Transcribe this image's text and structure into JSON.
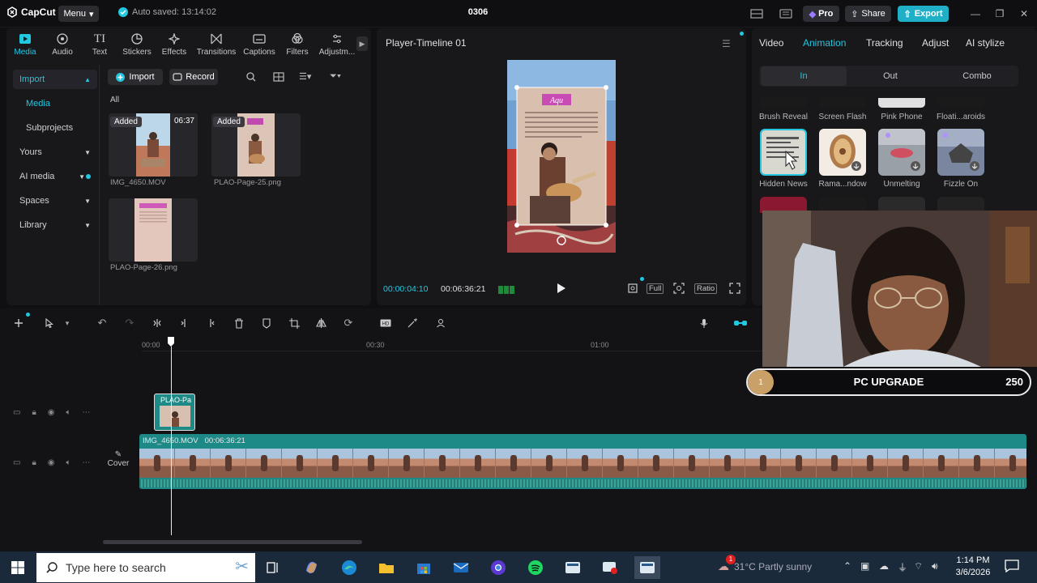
{
  "app": {
    "name": "CapCut",
    "menu_label": "Menu",
    "autosave_text": "Auto saved: 13:14:02",
    "project_name": "0306",
    "pro_label": "Pro",
    "share_label": "Share",
    "export_label": "Export"
  },
  "media_toolbar": {
    "tabs": [
      {
        "label": "Media",
        "icon": "media-icon"
      },
      {
        "label": "Audio",
        "icon": "audio-icon"
      },
      {
        "label": "Text",
        "icon": "text-icon"
      },
      {
        "label": "Stickers",
        "icon": "stickers-icon"
      },
      {
        "label": "Effects",
        "icon": "effects-icon"
      },
      {
        "label": "Transitions",
        "icon": "transitions-icon"
      },
      {
        "label": "Captions",
        "icon": "captions-icon"
      },
      {
        "label": "Filters",
        "icon": "filters-icon"
      },
      {
        "label": "Adjustm...",
        "icon": "adjustment-icon"
      }
    ]
  },
  "sidebar": {
    "items": [
      {
        "label": "Import"
      },
      {
        "label": "Media"
      },
      {
        "label": "Subprojects"
      },
      {
        "label": "Yours"
      },
      {
        "label": "AI media"
      },
      {
        "label": "Spaces"
      },
      {
        "label": "Library"
      }
    ]
  },
  "media": {
    "import_label": "Import",
    "record_label": "Record",
    "filter_all": "All",
    "items": [
      {
        "name": "IMG_4650.MOV",
        "badge": "Added",
        "duration": "06:37"
      },
      {
        "name": "PLAO-Page-25.png",
        "badge": "Added",
        "duration": ""
      },
      {
        "name": "PLAO-Page-26.png",
        "badge": "",
        "duration": ""
      }
    ]
  },
  "player": {
    "title": "Player-Timeline 01",
    "current_time": "00:00:04:10",
    "total_time": "00:06:36:21",
    "full_label": "Full",
    "ratio_label": "Ratio",
    "poster_title": "Aqu"
  },
  "right_panel": {
    "tabs": [
      "Video",
      "Animation",
      "Tracking",
      "Adjust",
      "AI stylize"
    ],
    "active_tab": "Animation",
    "subtabs": [
      "In",
      "Out",
      "Combo"
    ],
    "active_subtab": "In",
    "row1": [
      "Brush Reveal",
      "Screen Flash",
      "Pink Phone",
      "Floati...aroids"
    ],
    "row2": [
      "Hidden News",
      "Rama...ndow",
      "Unmelting",
      "Fizzle On"
    ]
  },
  "timeline": {
    "ruler": [
      "00:00",
      "00:30",
      "01:00"
    ],
    "overlay_clip_label": "PLAO-Pa",
    "main_clip_name": "IMG_4650.MOV",
    "main_clip_duration": "00:06:36:21",
    "cover_label": "Cover"
  },
  "overlay": {
    "rank": "1",
    "goal_label": "PC UPGRADE",
    "goal_value": "250"
  },
  "taskbar": {
    "search_placeholder": "Type here to search",
    "weather": "31°C  Partly sunny",
    "time": "1:14 PM",
    "date": "3/6/2026",
    "notification_count": "1"
  },
  "colors": {
    "accent": "#22c7e0",
    "export": "#1fb0c8",
    "clip": "#1d8a87"
  }
}
